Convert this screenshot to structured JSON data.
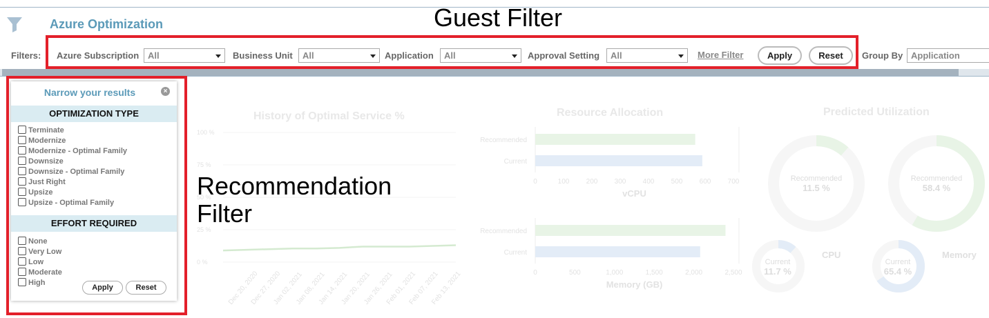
{
  "header": {
    "title": "Azure Optimization"
  },
  "annotations": {
    "guest_filter": "Guest Filter",
    "recommendation_filter": "Recommendation Filter"
  },
  "filters": {
    "label": "Filters:",
    "azure_subscription": {
      "label": "Azure Subscription",
      "value": "All"
    },
    "business_unit": {
      "label": "Business Unit",
      "value": "All"
    },
    "application": {
      "label": "Application",
      "value": "All"
    },
    "approval_setting": {
      "label": "Approval Setting",
      "value": "All"
    },
    "more_filter": "More Filter",
    "apply": "Apply",
    "reset": "Reset",
    "group_by": {
      "label": "Group By",
      "value": "Application"
    }
  },
  "narrow_panel": {
    "title": "Narrow your results",
    "optimization_type": {
      "heading": "OPTIMIZATION TYPE",
      "options": [
        "Terminate",
        "Modernize",
        "Modernize - Optimal Family",
        "Downsize",
        "Downsize - Optimal Family",
        "Just Right",
        "Upsize",
        "Upsize - Optimal Family"
      ]
    },
    "effort_required": {
      "heading": "EFFORT REQUIRED",
      "options": [
        "None",
        "Very Low",
        "Low",
        "Moderate",
        "High"
      ]
    },
    "apply": "Apply",
    "reset": "Reset"
  },
  "colors": {
    "accent": "#5b9ab8",
    "red_box": "#e3202a",
    "faint_green": "#e9f5e6",
    "faint_blue": "#e6eef8"
  },
  "chart_data": [
    {
      "type": "line",
      "title": "History of Optimal Service %",
      "y_ticks": [
        "100 %",
        "75 %",
        "50 %",
        "25 %",
        "0 %"
      ],
      "ylim": [
        0,
        100
      ],
      "categories": [
        "Dec 20, 2020",
        "Dec 27, 2020",
        "Jan 02, 2021",
        "Jan 08, 2021",
        "Jan 14, 2021",
        "Jan 20, 2021",
        "Jan 26, 2021",
        "Feb 01, 2021",
        "Feb 07, 2021",
        "Feb 13, 2021"
      ],
      "series": [
        {
          "values": [
            9,
            9.5,
            10,
            10.5,
            10.5,
            11,
            12,
            12,
            12,
            12.5,
            13
          ]
        }
      ]
    },
    {
      "type": "bar",
      "title": "Resource Allocation",
      "xlabel": "vCPU",
      "categories": [
        "Recommended",
        "Current"
      ],
      "values": [
        565,
        590
      ],
      "x_ticks": [
        "0",
        "100",
        "200",
        "300",
        "400",
        "500",
        "600",
        "700"
      ],
      "xlim": [
        0,
        700
      ]
    },
    {
      "type": "bar",
      "xlabel": "Memory (GB)",
      "categories": [
        "Recommended",
        "Current"
      ],
      "values": [
        2400,
        2080
      ],
      "x_ticks": [
        "0",
        "500",
        "1,000",
        "1,500",
        "2,000",
        "2,500"
      ],
      "xlim": [
        0,
        2500
      ]
    },
    {
      "type": "pie",
      "title": "Predicted Utilization",
      "groups": [
        {
          "name": "CPU",
          "recommended_label": "Recommended",
          "recommended": "11.5 %",
          "recommended_value": 11.5,
          "current_label": "Current",
          "current": "11.7 %",
          "current_value": 11.7
        },
        {
          "name": "Memory",
          "recommended_label": "Recommended",
          "recommended": "58.4 %",
          "recommended_value": 58.4,
          "current_label": "Current",
          "current": "65.4 %",
          "current_value": 65.4
        }
      ]
    }
  ]
}
